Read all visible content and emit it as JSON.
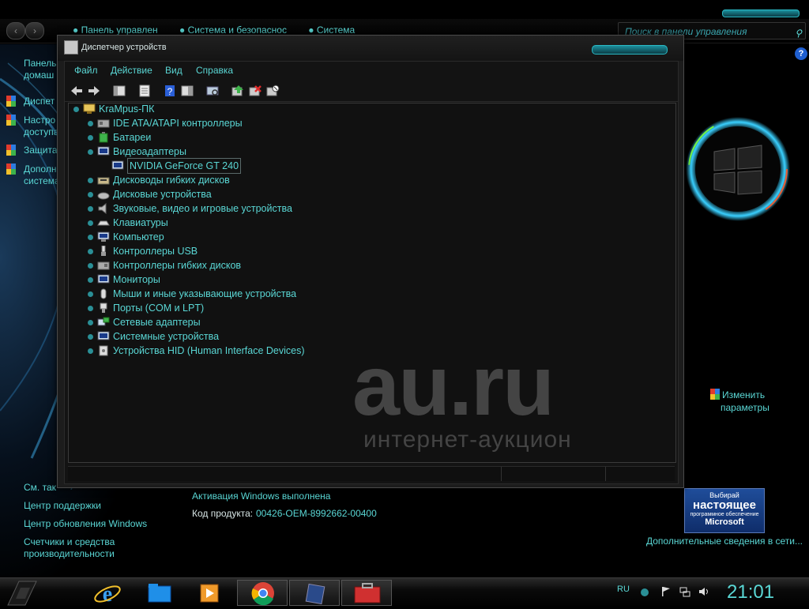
{
  "control_panel": {
    "breadcrumb": [
      "Панель управлен",
      "Система и безопаснос",
      "Система"
    ],
    "search_placeholder": "Поиск в панели управления",
    "left_nav": {
      "home": [
        "Панель",
        "домаш"
      ],
      "links": [
        [
          "Диспет"
        ],
        [
          "Настро",
          "доступа"
        ],
        [
          "Защита"
        ],
        [
          "Дополн",
          "система"
        ]
      ],
      "see_also": "См. так",
      "support": "Центр поддержки",
      "update": "Центр обновления Windows",
      "counters": [
        "Счетчики и средства",
        "производительности"
      ]
    },
    "activation": "Активация Windows выполнена",
    "product_key_label": "Код продукта:",
    "product_key_value": "00426-OEM-8992662-00400",
    "change_params": [
      "Изменить",
      "параметры"
    ],
    "badge": [
      "Выбирай",
      "настоящее",
      "программное обеспечение",
      "Microsoft"
    ],
    "more_info": "Дополнительные сведения в сети..."
  },
  "device_manager": {
    "title": "Диспетчер устройств",
    "menu": [
      "Файл",
      "Действие",
      "Вид",
      "Справка"
    ],
    "root": "KraMpus-ПК",
    "categories": [
      "IDE ATA/ATAPI контроллеры",
      "Батареи",
      "Видеоадаптеры",
      "Дисководы гибких дисков",
      "Дисковые устройства",
      "Звуковые, видео и игровые устройства",
      "Клавиатуры",
      "Компьютер",
      "Контроллеры USB",
      "Контроллеры гибких дисков",
      "Мониторы",
      "Мыши и иные указывающие устройства",
      "Порты (COM и LPT)",
      "Сетевые адаптеры",
      "Системные устройства",
      "Устройства HID (Human Interface Devices)"
    ],
    "video_child": "NVIDIA GeForce GT 240"
  },
  "watermark": {
    "big": "au.ru",
    "small": "интернет-аукцион"
  },
  "taskbar": {
    "lang": "RU",
    "time": "21:01"
  },
  "colors": {
    "accent": "#5ad7d5",
    "background": "#000000",
    "window": "#1c1c1c"
  }
}
